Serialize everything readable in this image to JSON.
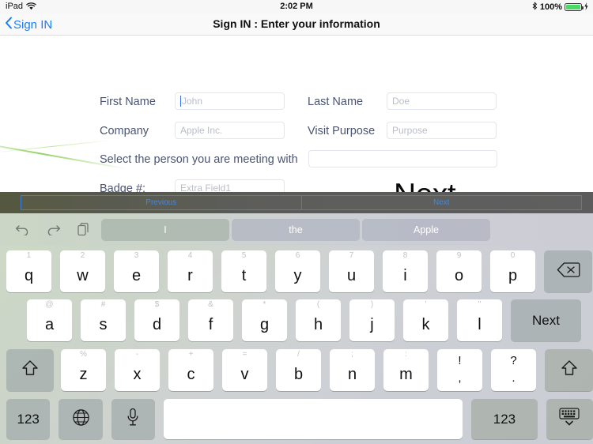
{
  "status_bar": {
    "device": "iPad",
    "wifi_icon": "wifi-icon",
    "time": "2:02 PM",
    "bluetooth_icon": "bluetooth-icon",
    "battery_percent": "100%",
    "battery_icon": "battery-full-icon",
    "charging_icon": "charging-bolt-icon",
    "battery_color": "#4cd964"
  },
  "nav_bar": {
    "back_icon": "chevron-left-icon",
    "back_label": "Sign IN",
    "title": "Sign IN : Enter your information",
    "tint_color": "#1a7cf7"
  },
  "form": {
    "fields": [
      {
        "label": "First Name",
        "placeholder": "John",
        "value": "",
        "focused": true
      },
      {
        "label": "Last Name",
        "placeholder": "Doe",
        "value": "",
        "focused": false
      },
      {
        "label": "Company",
        "placeholder": "Apple Inc.",
        "value": "",
        "focused": false
      },
      {
        "label": "Visit Purpose",
        "placeholder": "Purpose",
        "value": "",
        "focused": false
      },
      {
        "label": "Select the person you are meeting with",
        "placeholder": "",
        "value": "",
        "focused": false
      },
      {
        "label": "Badge #:",
        "placeholder": "Extra Field1",
        "value": "",
        "focused": false
      }
    ],
    "next_button": "Next",
    "label_color": "#4a5472",
    "placeholder_color": "#b9bdc9"
  },
  "accessory_bar": {
    "previous_label": "Previous",
    "next_label": "Next",
    "tint_color": "#3f8ae0"
  },
  "predictive_bar": {
    "undo_icon": "undo-icon",
    "redo_icon": "redo-icon",
    "paste_icon": "copy-paste-icon",
    "suggestions": [
      "I",
      "the",
      "Apple"
    ]
  },
  "keyboard": {
    "row1": [
      {
        "alt": "1",
        "main": "q"
      },
      {
        "alt": "2",
        "main": "w"
      },
      {
        "alt": "3",
        "main": "e"
      },
      {
        "alt": "4",
        "main": "r"
      },
      {
        "alt": "5",
        "main": "t"
      },
      {
        "alt": "6",
        "main": "y"
      },
      {
        "alt": "7",
        "main": "u"
      },
      {
        "alt": "8",
        "main": "i"
      },
      {
        "alt": "9",
        "main": "o"
      },
      {
        "alt": "0",
        "main": "p"
      }
    ],
    "backspace_icon": "backspace-icon",
    "row2": [
      {
        "alt": "@",
        "main": "a"
      },
      {
        "alt": "#",
        "main": "s"
      },
      {
        "alt": "$",
        "main": "d"
      },
      {
        "alt": "&",
        "main": "f"
      },
      {
        "alt": "*",
        "main": "g"
      },
      {
        "alt": "(",
        "main": "h"
      },
      {
        "alt": ")",
        "main": "j"
      },
      {
        "alt": "'",
        "main": "k"
      },
      {
        "alt": "\"",
        "main": "l"
      }
    ],
    "return_label": "Next",
    "row3": [
      {
        "alt": "%",
        "main": "z"
      },
      {
        "alt": "-",
        "main": "x"
      },
      {
        "alt": "+",
        "main": "c"
      },
      {
        "alt": "=",
        "main": "v"
      },
      {
        "alt": "/",
        "main": "b"
      },
      {
        "alt": ";",
        "main": "n"
      },
      {
        "alt": ":",
        "main": "m"
      }
    ],
    "punct_keys": [
      {
        "upper": "!",
        "lower": ","
      },
      {
        "upper": "?",
        "lower": "."
      }
    ],
    "shift_left_icon": "shift-icon",
    "shift_right_icon": "shift-icon",
    "numeric_left_label": "123",
    "globe_icon": "globe-icon",
    "mic_icon": "microphone-icon",
    "space_label": "",
    "numeric_right_label": "123",
    "dismiss_icon": "hide-keyboard-icon"
  }
}
